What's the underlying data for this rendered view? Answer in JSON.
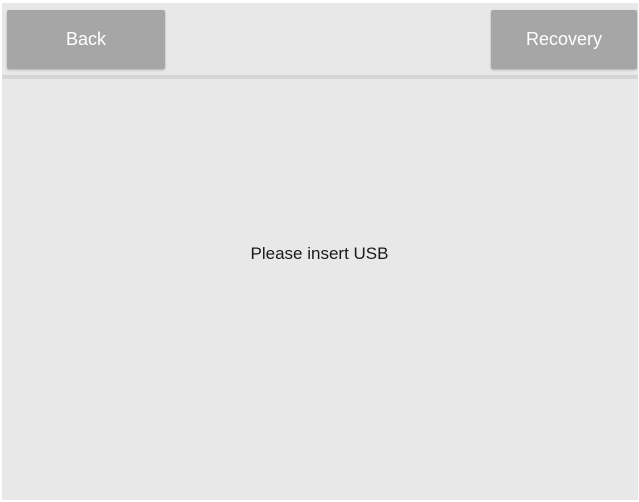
{
  "toolbar": {
    "back_label": "Back",
    "recovery_label": "Recovery"
  },
  "main": {
    "message": "Please insert USB"
  },
  "colors": {
    "background": "#e8e8e8",
    "button": "#a6a6a6",
    "button_text": "#ffffff",
    "message_text": "#1a1a1a",
    "divider": "#d6d6d6"
  }
}
